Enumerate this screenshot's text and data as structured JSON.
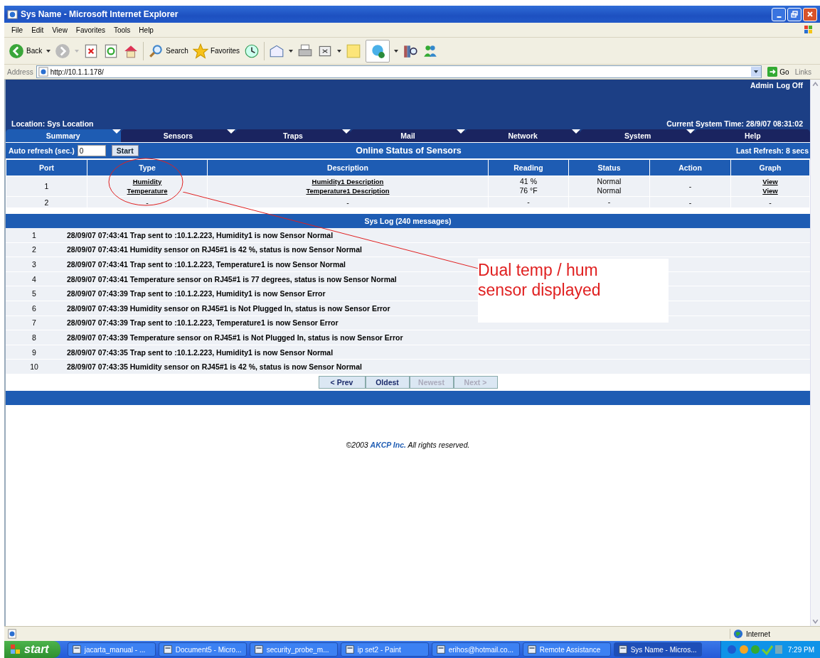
{
  "window": {
    "title": "Sys Name - Microsoft Internet Explorer"
  },
  "menu": [
    "File",
    "Edit",
    "View",
    "Favorites",
    "Tools",
    "Help"
  ],
  "toolbar": {
    "back": "Back",
    "search": "Search",
    "favorites": "Favorites"
  },
  "address": {
    "label": "Address",
    "url": "http://10.1.1.178/",
    "go": "Go",
    "links": "Links"
  },
  "header": {
    "admin_links": [
      "Admin",
      "Log Off"
    ],
    "location": "Location: Sys Location",
    "system_time": "Current System Time: 28/9/07 08:31:02"
  },
  "tabs": [
    {
      "label": "Summary",
      "selected": true
    },
    {
      "label": "Sensors",
      "selected": false
    },
    {
      "label": "Traps",
      "selected": false
    },
    {
      "label": "Mail",
      "selected": false
    },
    {
      "label": "Network",
      "selected": false
    },
    {
      "label": "System",
      "selected": false
    },
    {
      "label": "Help",
      "selected": false
    }
  ],
  "auto_refresh": {
    "label": "Auto refresh (sec.)",
    "value": "0",
    "button": "Start"
  },
  "title": "Online Status of Sensors",
  "last_refresh": "Last Refresh: 8 secs",
  "sensor_table": {
    "columns": [
      "Port",
      "Type",
      "Description",
      "Reading",
      "Status",
      "Action",
      "Graph"
    ],
    "rows": [
      {
        "port": "1",
        "type": [
          "Humidity",
          "Temperature"
        ],
        "description": [
          "Humidity1 Description",
          "Temperature1 Description"
        ],
        "reading": [
          "41 %",
          "76 °F"
        ],
        "status": [
          "Normal",
          "Normal"
        ],
        "action": "-",
        "graph": [
          "View",
          "View"
        ]
      },
      {
        "port": "2",
        "type": [
          "-"
        ],
        "description": [
          "-"
        ],
        "reading": [
          "-"
        ],
        "status": [
          "-"
        ],
        "action": "-",
        "graph": [
          "-"
        ]
      }
    ]
  },
  "syslog": {
    "title": "Sys Log (240 messages)",
    "entries": [
      {
        "index": "1",
        "text": "28/09/07 07:43:41 Trap sent to :10.1.2.223, Humidity1 is now Sensor Normal"
      },
      {
        "index": "2",
        "text": "28/09/07 07:43:41 Humidity sensor on RJ45#1 is 42 %, status is now Sensor Normal"
      },
      {
        "index": "3",
        "text": "28/09/07 07:43:41 Trap sent to :10.1.2.223, Temperature1 is now Sensor Normal"
      },
      {
        "index": "4",
        "text": "28/09/07 07:43:41 Temperature sensor on RJ45#1 is 77 degrees, status is now Sensor Normal"
      },
      {
        "index": "5",
        "text": "28/09/07 07:43:39 Trap sent to :10.1.2.223, Humidity1 is now Sensor Error"
      },
      {
        "index": "6",
        "text": "28/09/07 07:43:39 Humidity sensor on RJ45#1 is Not Plugged In, status is now Sensor Error"
      },
      {
        "index": "7",
        "text": "28/09/07 07:43:39 Trap sent to :10.1.2.223, Temperature1 is now Sensor Error"
      },
      {
        "index": "8",
        "text": "28/09/07 07:43:39 Temperature sensor on RJ45#1 is Not Plugged In, status is now Sensor Error"
      },
      {
        "index": "9",
        "text": "28/09/07 07:43:35 Trap sent to :10.1.2.223, Humidity1 is now Sensor Normal"
      },
      {
        "index": "10",
        "text": "28/09/07 07:43:35 Humidity sensor on RJ45#1 is 42 %, status is now Sensor Normal"
      }
    ],
    "pagination": [
      {
        "label": "< Prev",
        "disabled": false
      },
      {
        "label": "Oldest",
        "disabled": false
      },
      {
        "label": "Newest",
        "disabled": true
      },
      {
        "label": "Next >",
        "disabled": true
      }
    ]
  },
  "footer": "©2003 **AKCP Inc.** All rights reserved.",
  "annotation": "Dual temp / hum sensor displayed",
  "status_bar": {
    "zone": "Internet"
  },
  "taskbar": {
    "start": "start",
    "tasks": [
      {
        "label": "jacarta_manual - ...",
        "selected": false
      },
      {
        "label": "Document5 - Micro...",
        "selected": false
      },
      {
        "label": "security_probe_m...",
        "selected": false
      },
      {
        "label": "ip set2 - Paint",
        "selected": false
      },
      {
        "label": "erihos@hotmail.co...",
        "selected": false
      },
      {
        "label": "Remote Assistance",
        "selected": false
      },
      {
        "label": "Sys Name - Micros...",
        "selected": true
      }
    ],
    "clock": "7:29 PM"
  }
}
